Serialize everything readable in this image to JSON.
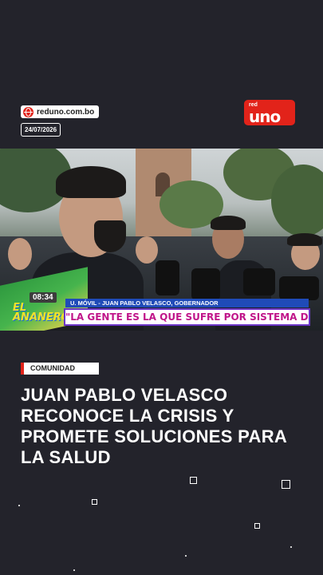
{
  "header": {
    "site": "reduno.com.bo",
    "date": "24/07/2026",
    "logo_small": "red",
    "logo_big": "uno"
  },
  "video": {
    "show_time": "08:34",
    "show_name": "EL ANANERO",
    "ticker_top": "U. MÓVIL - JUAN PABLO VELASCO, GOBERNADOR",
    "ticker_main": "\"LA GENTE ES LA QUE SUFRE POR SISTEMA DE SALUD\""
  },
  "article": {
    "category": "COMUNIDAD",
    "headline": "JUAN PABLO VELASCO RECONOCE LA CRISIS Y PROMETE SOLUCIONES PARA LA SALUD"
  },
  "colors": {
    "background": "#23232b",
    "brand_red": "#e2231a",
    "ticker_blue": "#1f4bb8",
    "ticker_magenta": "#c0168a"
  }
}
